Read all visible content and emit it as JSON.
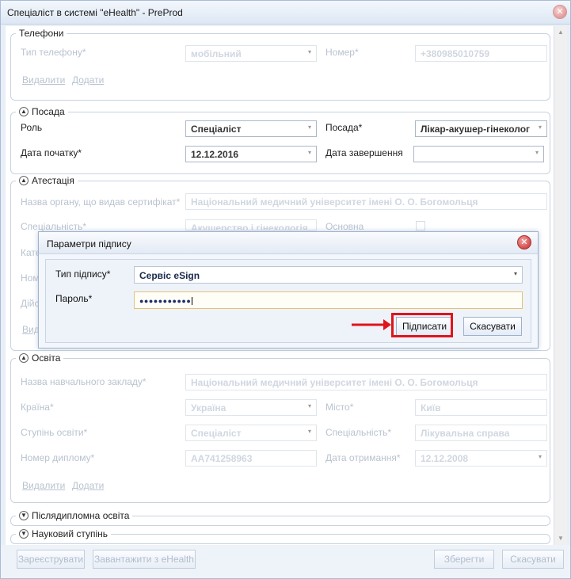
{
  "window": {
    "title": "Спеціаліст в системі \"eHealth\" - PreProd"
  },
  "phones": {
    "legend": "Телефони",
    "type_label": "Тип телефону*",
    "type_value": "мобільний",
    "number_label": "Номер*",
    "number_value": "+380985010759",
    "delete_link": "Видалити",
    "add_link": "Додати"
  },
  "position": {
    "legend": "Посада",
    "role_label": "Роль",
    "role_value": "Спеціаліст",
    "post_label": "Посада*",
    "post_value": "Лікар-акушер-гінеколог",
    "start_label": "Дата початку*",
    "start_value": "12.12.2016",
    "end_label": "Дата завершення",
    "end_value": ""
  },
  "attestation": {
    "legend": "Атестація",
    "org_label": "Назва органу, що видав сертифікат*",
    "org_value": "Національний медичний університет імені О. О. Богомольця",
    "spec_label": "Спеціальність*",
    "spec_value": "Акушерство і гінекологія",
    "main_label": "Основна",
    "partial_1": "Кате",
    "partial_2": "Ном",
    "partial_3": "Дійс",
    "partial_link": "Вид"
  },
  "education": {
    "legend": "Освіта",
    "inst_label": "Назва навчального закладу*",
    "inst_value": "Національний медичний університет імені О. О. Богомольця",
    "country_label": "Країна*",
    "country_value": "Україна",
    "city_label": "Місто*",
    "city_value": "Київ",
    "degree_label": "Ступінь освіти*",
    "degree_value": "Спеціаліст",
    "specialty_label": "Спеціальність*",
    "specialty_value": "Лікувальна справа",
    "diploma_label": "Номер диплому*",
    "diploma_value": "AA741258963",
    "received_label": "Дата отримання*",
    "received_value": "12.12.2008",
    "delete_link": "Видалити",
    "add_link": "Додати"
  },
  "postgrad": {
    "legend": "Післядипломна освіта"
  },
  "degree": {
    "legend": "Науковий ступінь"
  },
  "footer": {
    "register": "Зареєструвати",
    "load": "Завантажити з eHealth",
    "save": "Зберегти",
    "cancel": "Скасувати"
  },
  "dialog": {
    "title": "Параметри підпису",
    "sign_type_label": "Тип підпису*",
    "sign_type_value": "Сервіс eSign",
    "password_label": "Пароль*",
    "password_value": "●●●●●●●●●●●",
    "sign_button": "Підписати",
    "cancel_button": "Скасувати"
  },
  "colors": {
    "annotation": "#e0141c",
    "accent": "#9db3d1"
  }
}
